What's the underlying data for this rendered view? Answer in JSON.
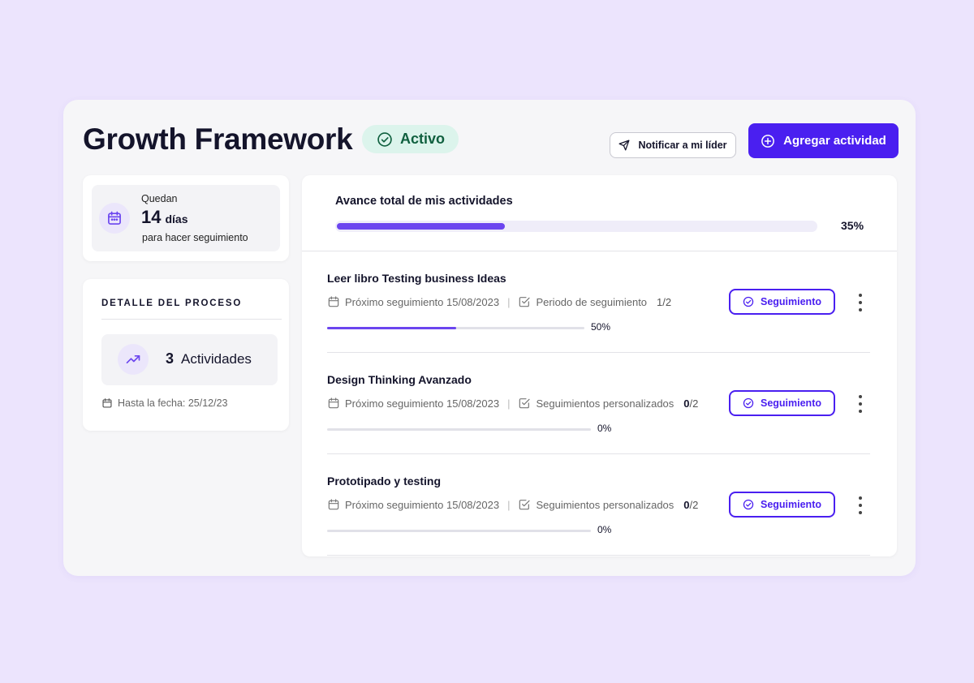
{
  "header": {
    "title": "Growth Framework",
    "status": "Activo",
    "notify_label": "Notificar a mi líder",
    "add_label": "Agregar actividad"
  },
  "days_card": {
    "remaining_label": "Quedan",
    "days_value": "14",
    "days_unit": "días",
    "subtitle": "para hacer seguimiento"
  },
  "detail_card": {
    "title": "DETALLE DEL PROCESO",
    "activities_count": "3",
    "activities_label": "Actividades",
    "date_label": "Hasta la fecha: 25/12/23"
  },
  "progress": {
    "label": "Avance total de mis actividades",
    "percent_label": "35%",
    "percent": 0.35
  },
  "activities": [
    {
      "name": "Leer libro Testing business Ideas",
      "next_followup": "Próximo seguimiento 15/08/2023",
      "period_label": "Periodo de seguimiento",
      "count_done": "",
      "count_total": "1/2",
      "progress_label": "50%",
      "progress": 0.5,
      "button_label": "Seguimiento"
    },
    {
      "name": "Design Thinking Avanzado",
      "next_followup": "Próximo seguimiento 15/08/2023",
      "period_label": "Seguimientos personalizados",
      "count_done": "0",
      "count_total": "/2",
      "progress_label": "0%",
      "progress": 0,
      "button_label": "Seguimiento"
    },
    {
      "name": "Prototipado y testing",
      "next_followup": "Próximo seguimiento 15/08/2023",
      "period_label": "Seguimientos personalizados",
      "count_done": "0",
      "count_total": "/2",
      "progress_label": "0%",
      "progress": 0,
      "button_label": "Seguimiento"
    }
  ],
  "colors": {
    "accent": "#4a1ff0",
    "progress": "#6b45ef",
    "active_badge_bg": "#dcf4ec",
    "active_badge_text": "#10603f",
    "background": "#ece4fd"
  },
  "icons": {
    "status": "check-circle-icon",
    "notify": "send-icon",
    "add": "plus-circle-icon",
    "days": "calendar-icon",
    "activities": "trending-up-icon",
    "date": "calendar-icon",
    "followup": "check-circle-icon",
    "checkbox": "checkbox-icon",
    "more": "more-vertical-icon"
  }
}
